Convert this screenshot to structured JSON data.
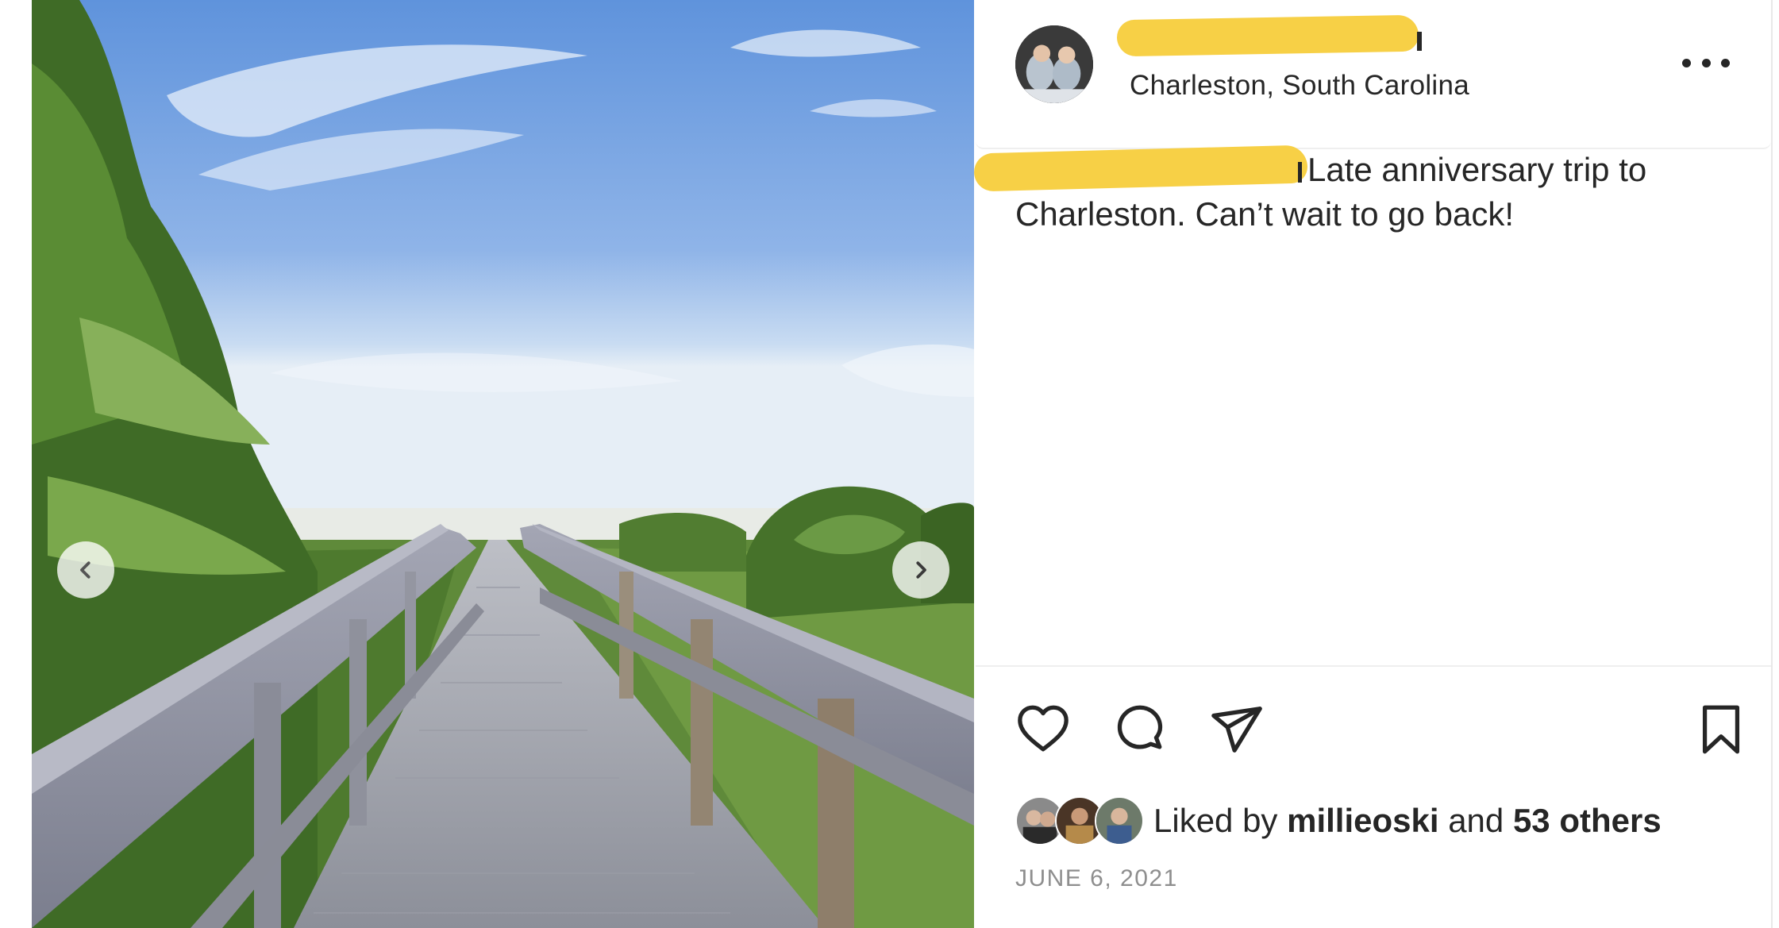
{
  "post": {
    "location": "Charleston, South Carolina",
    "caption": "Late anniversary trip to Charleston. Can’t wait to go back!",
    "liked_by_prefix": "Liked by",
    "liked_by_user": "millieoski",
    "liked_by_and": "and",
    "liked_by_others": "53 others",
    "date": "JUNE 6, 2021"
  },
  "icons": {
    "prev": "chevron-left-icon",
    "next": "chevron-right-icon",
    "more": "more-horizontal-icon",
    "like": "heart-icon",
    "comment": "comment-icon",
    "share": "send-icon",
    "save": "bookmark-icon"
  },
  "colors": {
    "redaction": "#f7d046",
    "text": "#262626",
    "secondary_text": "#8e8e8e",
    "divider": "#efefef"
  }
}
